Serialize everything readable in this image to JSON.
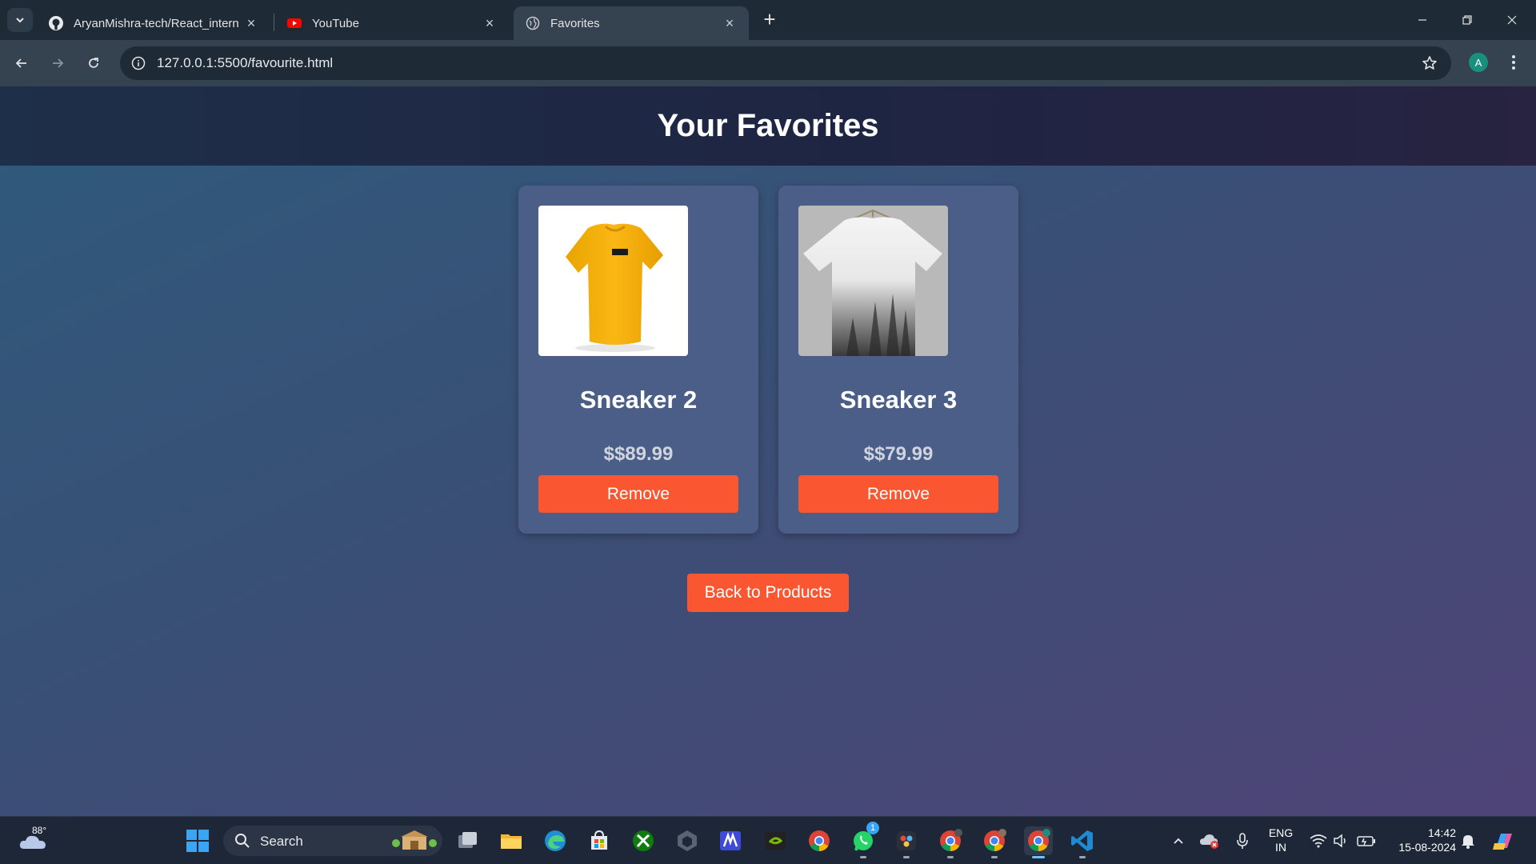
{
  "browser": {
    "tabs": [
      {
        "title": "AryanMishra-tech/React_intern",
        "icon": "github-icon"
      },
      {
        "title": "YouTube",
        "icon": "youtube-icon"
      },
      {
        "title": "Favorites",
        "icon": "globe-icon",
        "active": true
      }
    ],
    "url": "127.0.0.1:5500/favourite.html",
    "profile_initial": "A"
  },
  "page": {
    "title": "Your Favorites",
    "favorites": [
      {
        "name": "Sneaker 2",
        "price": "$$89.99",
        "remove_label": "Remove",
        "image": "yellow t-shirt with ARR print"
      },
      {
        "name": "Sneaker 3",
        "price": "$$79.99",
        "remove_label": "Remove",
        "image": "white t-shirt with misty forest print"
      }
    ],
    "back_label": "Back to Products"
  },
  "taskbar": {
    "weather_temp": "88°",
    "search_label": "Search",
    "whatsapp_badge": "1",
    "language": "ENG",
    "region": "IN",
    "time": "14:42",
    "date": "15-08-2024"
  },
  "colors": {
    "accent_button": "#fb5632",
    "card_bg": "#4b5e87",
    "header_bg": "#1e2543"
  }
}
